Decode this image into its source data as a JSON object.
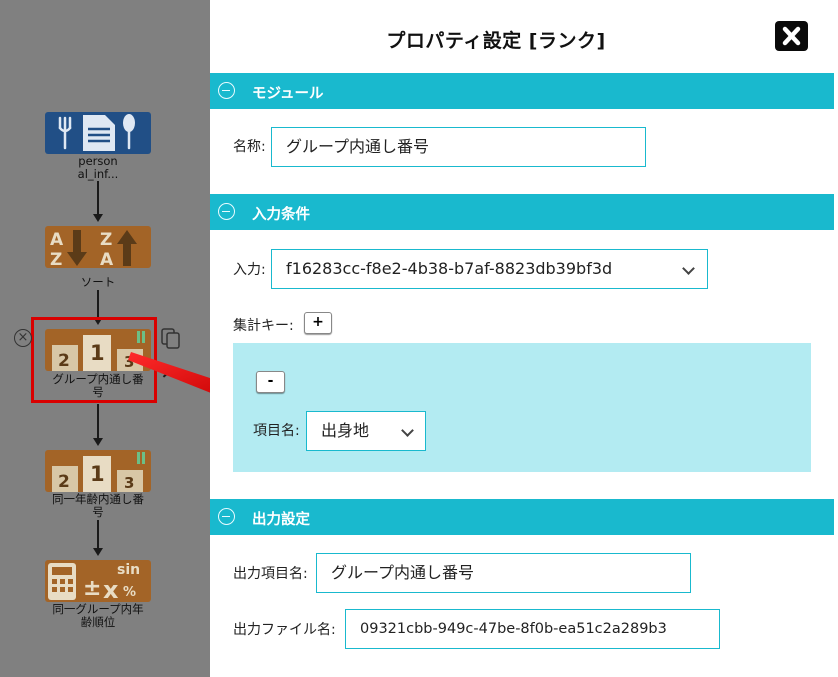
{
  "canvas": {
    "nodes": [
      {
        "label": "person\nal_inf...",
        "icon": "document-utensils-icon",
        "color": "#214f86"
      },
      {
        "label": "ソート",
        "icon": "sort-az-icon",
        "color": "#a36427"
      },
      {
        "label": "グループ内通し番\n号",
        "icon": "ranking-podium-icon",
        "color": "#a36427"
      },
      {
        "label": "同一年齢内通し番\n号",
        "icon": "ranking-podium-icon",
        "color": "#a36427"
      },
      {
        "label": "同一グループ内年\n齢順位",
        "icon": "calculator-math-icon",
        "color": "#a36427"
      }
    ],
    "highlight_color": "#d90000"
  },
  "modal": {
    "title": "プロパティ設定 [ランク]",
    "close_icon": "close-icon",
    "sections": {
      "module": {
        "title": "モジュール",
        "name_label": "名称:",
        "name_value": "グループ内通し番号"
      },
      "input_conditions": {
        "title": "入力条件",
        "input_label": "入力:",
        "input_value": "f16283cc-f8e2-4b38-b7af-8823db39bf3d",
        "agg_key_label": "集計キー:",
        "add_button": "+",
        "remove_button": "-",
        "item_label": "項目名:",
        "item_value": "出身地"
      },
      "output": {
        "title": "出力設定",
        "output_item_label": "出力項目名:",
        "output_item_value": "グループ内通し番号",
        "output_file_label": "出力ファイル名:",
        "output_file_value": "09321cbb-949c-47be-8f0b-ea51c2a289b3"
      }
    },
    "accent_color": "#19b9ce",
    "group_bg_color": "#b3ebf2"
  }
}
